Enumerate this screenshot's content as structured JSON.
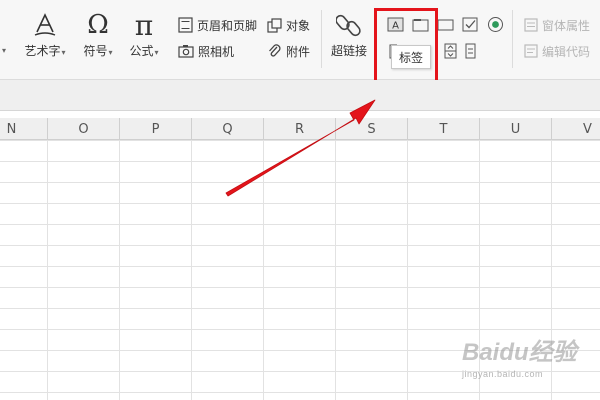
{
  "ribbon": {
    "art_text": "艺术字",
    "symbol": "符号",
    "formula": "公式",
    "header_footer": "页眉和页脚",
    "object": "对象",
    "camera": "照相机",
    "attachment": "附件",
    "hyperlink": "超链接",
    "form_properties": "窗体属性",
    "edit_code": "编辑代码"
  },
  "tooltip": {
    "text": "标签"
  },
  "columns": [
    "N",
    "O",
    "P",
    "Q",
    "R",
    "S",
    "T",
    "U",
    "V"
  ],
  "watermark": {
    "brand": "Baidu经验",
    "url": "jingyan.baidu.com"
  },
  "colors": {
    "highlight": "#e4141b",
    "arrow": "#e4141b"
  }
}
